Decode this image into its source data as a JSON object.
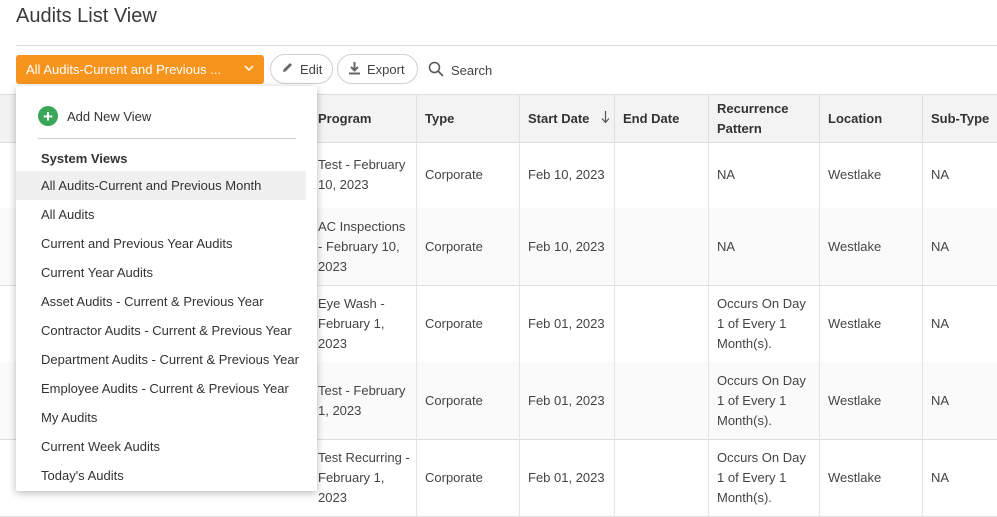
{
  "page": {
    "title": "Audits List View"
  },
  "toolbar": {
    "view_selected": "All Audits-Current and Previous ...",
    "edit_label": "Edit",
    "export_label": "Export",
    "search_label": "Search"
  },
  "table": {
    "columns": [
      "Program",
      "Type",
      "Start Date",
      "End Date",
      "Recurrence\nPattern",
      "Location",
      "Sub-Type"
    ],
    "rows": [
      {
        "program": "Test - February\n10, 2023",
        "type": "Corporate",
        "start": "Feb 10, 2023",
        "end": "",
        "recurrence": "NA",
        "location": "Westlake",
        "subtype": "NA"
      },
      {
        "program": "AC Inspections\n- February 10,\n2023",
        "type": "Corporate",
        "start": "Feb 10, 2023",
        "end": "",
        "recurrence": "NA",
        "location": "Westlake",
        "subtype": "NA"
      },
      {
        "program": "Eye Wash -\nFebruary 1,\n2023",
        "type": "Corporate",
        "start": "Feb 01, 2023",
        "end": "",
        "recurrence": "Occurs On Day\n1 of Every 1\nMonth(s).",
        "location": "Westlake",
        "subtype": "NA"
      },
      {
        "program": "Test - February\n1, 2023",
        "type": "Corporate",
        "start": "Feb 01, 2023",
        "end": "",
        "recurrence": "Occurs On Day\n1 of Every 1\nMonth(s).",
        "location": "Westlake",
        "subtype": "NA"
      },
      {
        "program": "Test Recurring -\nFebruary 1,\n2023",
        "type": "Corporate",
        "start": "Feb 01, 2023",
        "end": "",
        "recurrence": "Occurs On Day\n1 of Every 1\nMonth(s).",
        "location": "Westlake",
        "subtype": "NA"
      }
    ]
  },
  "menu": {
    "add_label": "Add New View",
    "section_label": "System Views",
    "items": [
      "All Audits-Current and Previous Month",
      "All Audits",
      "Current and Previous Year Audits",
      "Current Year Audits",
      "Asset Audits - Current & Previous Year",
      "Contractor Audits - Current & Previous Year",
      "Department Audits - Current & Previous Year",
      "Employee Audits - Current & Previous Year",
      "My Audits",
      "Current Week Audits",
      "Today's Audits"
    ]
  },
  "colors": {
    "accent": "#f7941d",
    "add_icon": "#3aa65a"
  }
}
